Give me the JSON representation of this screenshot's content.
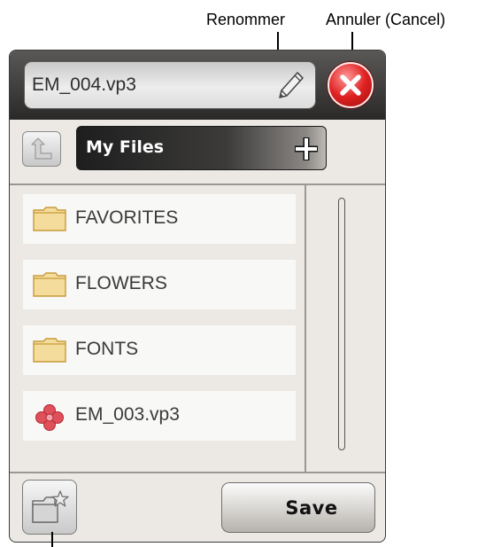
{
  "callouts": {
    "rename": "Renommer",
    "cancel": "Annuler (Cancel)"
  },
  "header": {
    "filename": "EM_004.vp3",
    "edit_icon": "pencil-icon",
    "cancel_icon": "close-icon",
    "cancel_color": "#e02222"
  },
  "navigation": {
    "up_icon": "folder-up-icon",
    "location": "My Files",
    "new_folder_icon": "plus-icon"
  },
  "files": [
    {
      "name": "FAVORITES",
      "icon": "folder-icon"
    },
    {
      "name": "FLOWERS",
      "icon": "folder-icon"
    },
    {
      "name": "FONTS",
      "icon": "folder-icon"
    },
    {
      "name": "EM_003.vp3",
      "icon": "embroidery-file-icon"
    }
  ],
  "footer": {
    "favorites_icon": "folder-star-icon",
    "save_label": "Save"
  }
}
